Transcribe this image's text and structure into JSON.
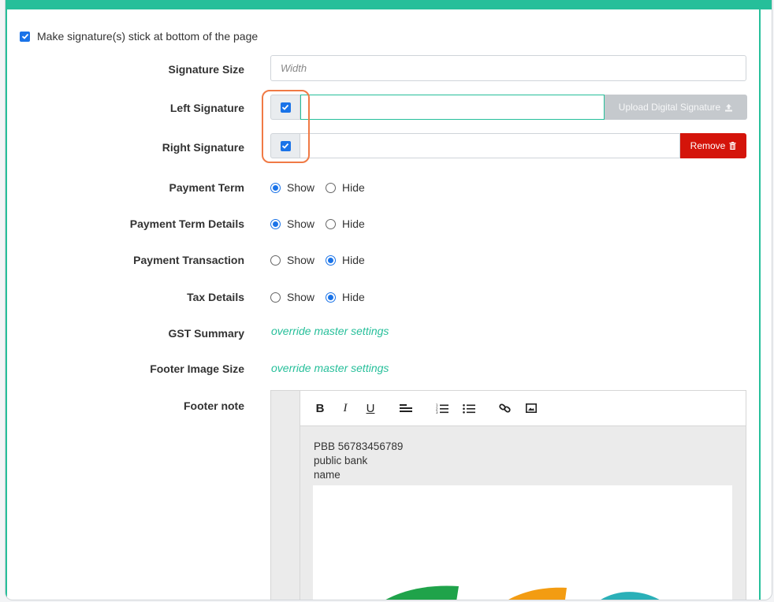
{
  "settings": {
    "stick_label": "Make signature(s) stick at bottom of the page",
    "signature_size": {
      "label": "Signature Size",
      "placeholder": "Width"
    },
    "left_signature": {
      "label": "Left Signature",
      "button": "Upload Digital Signature"
    },
    "right_signature": {
      "label": "Right Signature",
      "button": "Remove"
    },
    "payment_term": {
      "label": "Payment Term",
      "options": [
        "Show",
        "Hide"
      ],
      "selected": "Show"
    },
    "payment_term_details": {
      "label": "Payment Term Details",
      "options": [
        "Show",
        "Hide"
      ],
      "selected": "Show"
    },
    "payment_transaction": {
      "label": "Payment Transaction",
      "options": [
        "Show",
        "Hide"
      ],
      "selected": "Hide"
    },
    "tax_details": {
      "label": "Tax Details",
      "options": [
        "Show",
        "Hide"
      ],
      "selected": "Hide"
    },
    "gst_summary": {
      "label": "GST Summary",
      "link": "override master settings"
    },
    "footer_image_size": {
      "label": "Footer Image Size",
      "link": "override master settings"
    },
    "footer_note": {
      "label": "Footer note",
      "toolbar": {
        "bold": "B",
        "italic": "I",
        "underline": "U"
      },
      "lines": [
        "PBB 56783456789",
        "public bank",
        "name"
      ]
    }
  },
  "colors": {
    "accent": "#26bf9a",
    "checkbox": "#1a73e8",
    "remove_button": "#d4140a",
    "upload_button": "#c5c9cd",
    "highlight": "#f07a45"
  }
}
